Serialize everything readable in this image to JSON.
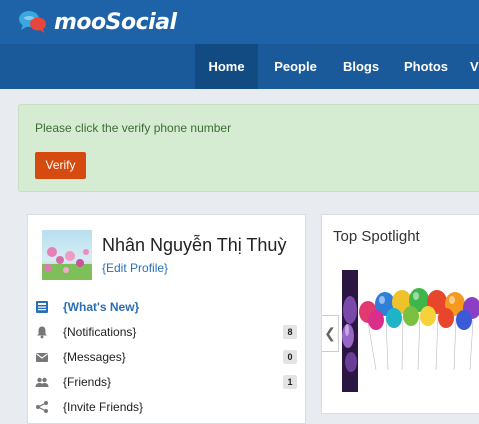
{
  "app": {
    "logo_text": "mooSocial"
  },
  "nav": {
    "items": [
      {
        "label": "Home",
        "active": true
      },
      {
        "label": "People"
      },
      {
        "label": "Blogs"
      },
      {
        "label": "Photos"
      },
      {
        "label": "V"
      }
    ]
  },
  "alert": {
    "message": "Please click the verify phone number",
    "button_label": "Verify"
  },
  "profile": {
    "name": "Nhân Nguyễn Thị Thuỳ",
    "edit_label": "{Edit Profile}"
  },
  "menu": {
    "items": [
      {
        "label": "{What's New}",
        "icon": "newspaper-icon",
        "active": true
      },
      {
        "label": "{Notifications}",
        "icon": "bell-icon",
        "count": "8"
      },
      {
        "label": "{Messages}",
        "icon": "envelope-icon",
        "count": "0"
      },
      {
        "label": "{Friends}",
        "icon": "people-icon",
        "count": "1"
      },
      {
        "label": "{Invite Friends}",
        "icon": "share-icon"
      }
    ]
  },
  "spotlight": {
    "title": "Top Spotlight",
    "prev_glyph": "❮"
  },
  "colors": {
    "topbar": "#1e62a8",
    "navbar": "#1a5a9a",
    "nav_active": "#124a82",
    "alert_bg": "#d6ecd2",
    "verify_button": "#d54a0f",
    "link": "#2a6fb5"
  }
}
